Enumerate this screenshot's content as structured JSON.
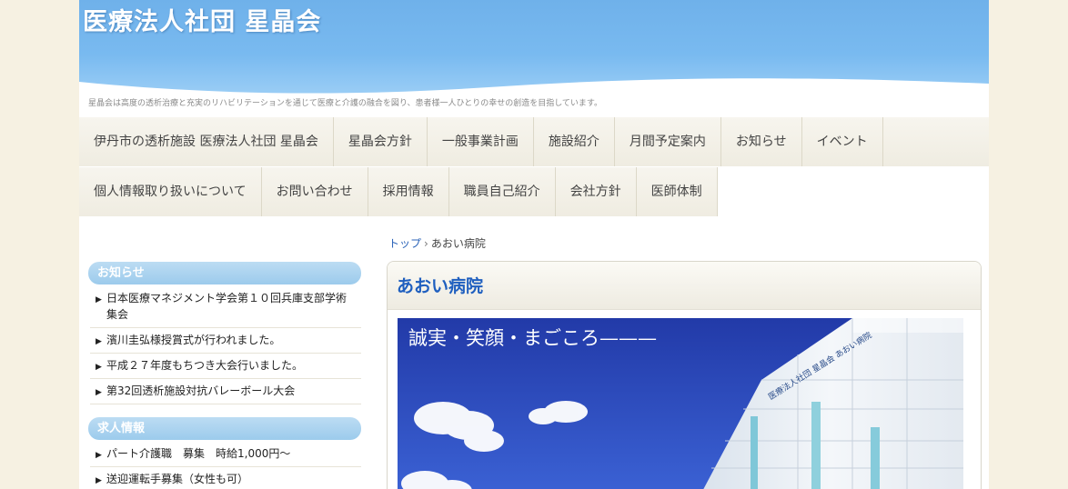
{
  "header": {
    "title": "医療法人社団 星晶会",
    "tagline": "星晶会は高度の透析治療と充実のリハビリテーションを通じて医療と介護の融合を図り、患者様一人ひとりの幸せの創造を目指しています。"
  },
  "nav": {
    "row1": [
      "伊丹市の透析施設 医療法人社団 星晶会",
      "星晶会方針",
      "一般事業計画",
      "施設紹介",
      "月間予定案内",
      "お知らせ",
      "イベント"
    ],
    "row2": [
      "個人情報取り扱いについて",
      "お問い合わせ",
      "採用情報",
      "職員自己紹介",
      "会社方針",
      "医師体制"
    ]
  },
  "sidebar": {
    "news": {
      "heading": "お知らせ",
      "items": [
        "日本医療マネジメント学会第１０回兵庫支部学術集会",
        "濱川圭弘様授賞式が行われました。",
        "平成２７年度もちつき大会行いました。",
        "第32回透析施設対抗バレーボール大会"
      ]
    },
    "jobs": {
      "heading": "求人情報",
      "items": [
        "パート介護職　募集　時給1,000円～",
        "送迎運転手募集（女性も可）"
      ]
    }
  },
  "breadcrumb": {
    "home": "トップ",
    "separator": "›",
    "current": "あおい病院"
  },
  "main": {
    "title": "あおい病院",
    "hero": {
      "caption": "誠実・笑顔・まごころ",
      "building_sign": "医療法人社団 星晶会 あおい病院"
    }
  },
  "colors": {
    "header_sky": "#79baf0",
    "title_blue": "#1f5fbf",
    "sidebar_heading": "#9ccbec",
    "page_background": "#f6f1e2",
    "hero_sky": "#2a3fbf"
  }
}
